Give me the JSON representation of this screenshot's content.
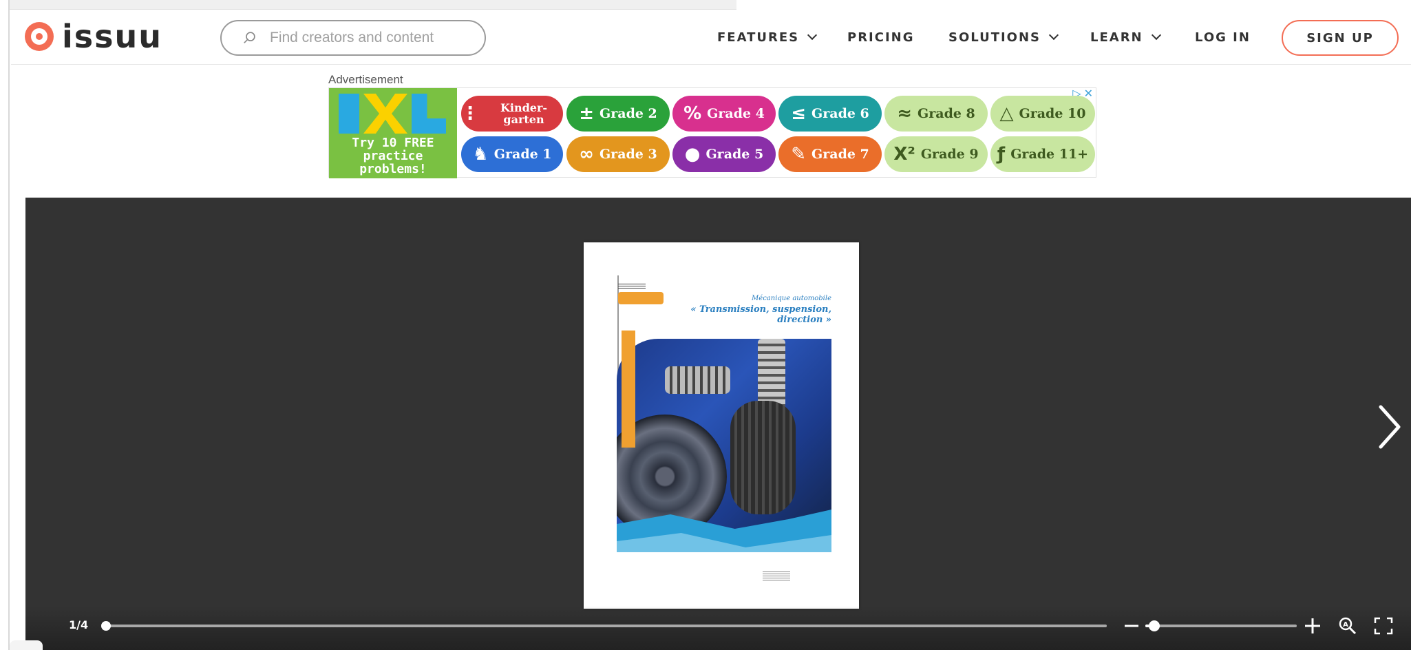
{
  "header": {
    "logo_text": "issuu",
    "search_placeholder": "Find creators and content",
    "nav": {
      "features": "FEATURES",
      "pricing": "PRICING",
      "solutions": "SOLUTIONS",
      "learn": "LEARN",
      "login": "LOG IN",
      "signup": "SIGN UP"
    },
    "accent_color": "#f36d54"
  },
  "advertisement": {
    "label": "Advertisement",
    "ixl_text": "Try 10 FREE practice problems!",
    "grades": [
      {
        "label": "Kinder-garten",
        "icon": "dots-icon",
        "color": "#d83a40"
      },
      {
        "label": "Grade 2",
        "icon": "plus-minus-icon",
        "color": "#2aa23a"
      },
      {
        "label": "Grade 4",
        "icon": "percent-icon",
        "color": "#d8308e"
      },
      {
        "label": "Grade 6",
        "icon": "less-equal-icon",
        "color": "#1e9ea0"
      },
      {
        "label": "Grade 8",
        "icon": "approx-icon",
        "color": "#c8e6a0"
      },
      {
        "label": "Grade 10",
        "icon": "triangle-icon",
        "color": "#c8e6a0"
      },
      {
        "label": "Grade 1",
        "icon": "cup-icon",
        "color": "#2d6fd6"
      },
      {
        "label": "Grade 3",
        "icon": "infinity-icon",
        "color": "#e3961e"
      },
      {
        "label": "Grade 5",
        "icon": "apple-icon",
        "color": "#8a2fa8"
      },
      {
        "label": "Grade 7",
        "icon": "pencil-icon",
        "color": "#ea6e2a"
      },
      {
        "label": "Grade 9",
        "icon": "x-squared-icon",
        "color": "#c8e6a0"
      },
      {
        "label": "Grade 11+",
        "icon": "function-icon",
        "color": "#c8e6a0"
      }
    ]
  },
  "viewer": {
    "page_indicator": "1/4",
    "progress_fraction": 0.0,
    "zoom_fraction": 0.06,
    "cover": {
      "subtitle": "Mécanique automobile",
      "title_line1": "« Transmission, suspension,",
      "title_line2": "direction »"
    }
  }
}
